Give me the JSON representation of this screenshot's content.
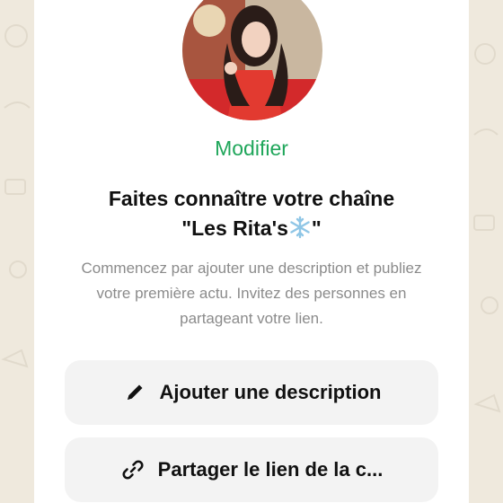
{
  "channel": {
    "edit_label": "Modifier",
    "title_line1": "Faites connaître votre chaîne",
    "title_line2_prefix": "\"Les Rita's",
    "title_line2_suffix": "\"",
    "description": "Commencez par ajouter une description et publiez votre première actu. Invitez des personnes en partageant votre lien."
  },
  "actions": {
    "add_description": "Ajouter une description",
    "share_link": "Partager le lien de la c..."
  },
  "colors": {
    "accent": "#1fa65a",
    "snowflake": "#8fc6e6"
  },
  "icons": {
    "add_description": "pencil-icon",
    "share_link": "link-icon",
    "title_emoji": "snowflake-icon"
  }
}
